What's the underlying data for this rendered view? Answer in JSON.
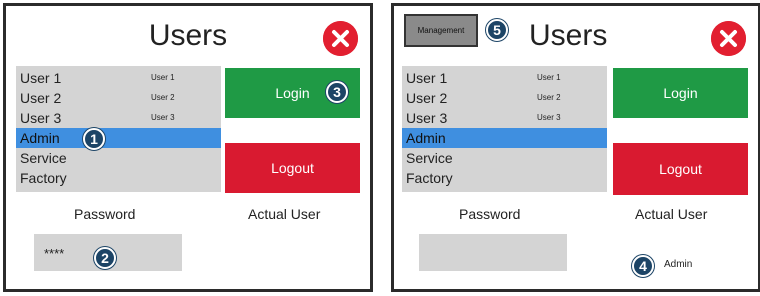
{
  "left": {
    "title": "Users",
    "users": [
      {
        "label": "User 1",
        "sub": "User 1"
      },
      {
        "label": "User 2",
        "sub": "User 2"
      },
      {
        "label": "User 3",
        "sub": "User 3"
      },
      {
        "label": "Admin",
        "sub": ""
      },
      {
        "label": "Service",
        "sub": ""
      },
      {
        "label": "Factory",
        "sub": ""
      }
    ],
    "login_label": "Login",
    "logout_label": "Logout",
    "password_label": "Password",
    "actual_user_label": "Actual User",
    "password_value": "****",
    "badges": {
      "b1": "1",
      "b2": "2",
      "b3": "3"
    }
  },
  "right": {
    "title": "Users",
    "management_label": "Management",
    "users": [
      {
        "label": "User 1",
        "sub": "User 1"
      },
      {
        "label": "User 2",
        "sub": "User 2"
      },
      {
        "label": "User 3",
        "sub": "User 3"
      },
      {
        "label": "Admin",
        "sub": ""
      },
      {
        "label": "Service",
        "sub": ""
      },
      {
        "label": "Factory",
        "sub": ""
      }
    ],
    "login_label": "Login",
    "logout_label": "Logout",
    "password_label": "Password",
    "actual_user_label": "Actual User",
    "password_value": "",
    "actual_user_value": "Admin",
    "badges": {
      "b4": "4",
      "b5": "5"
    }
  },
  "icons": {
    "close": "close-x-icon"
  },
  "colors": {
    "login": "#1f9a45",
    "logout": "#d91a30",
    "selected": "#3f8fe0",
    "close": "#e21f30",
    "badge": "#1c4466"
  }
}
